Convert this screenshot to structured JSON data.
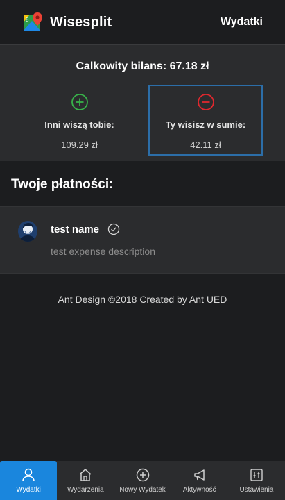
{
  "header": {
    "brand": "Wisesplit",
    "link": "Wydatki",
    "logo_icon": "map-pin-logo-icon"
  },
  "balance": {
    "total_label": "Calkowity bilans: 67.18 zł",
    "owed_to_you": {
      "label": "Inni wiszą tobie:",
      "value": "109.29 zł",
      "icon": "plus-circle-icon",
      "color": "#38b24a"
    },
    "you_owe": {
      "label": "Ty wisisz w sumie:",
      "value": "42.11 zł",
      "icon": "minus-circle-icon",
      "color": "#e0282e"
    }
  },
  "payments": {
    "title": "Twoje płatności:",
    "items": [
      {
        "name": "test name",
        "description": "test expense description",
        "status_icon": "check-circle-icon"
      }
    ]
  },
  "footer": {
    "text": "Ant Design ©2018 Created by Ant UED"
  },
  "nav": {
    "items": [
      {
        "label": "Wydatki",
        "icon": "user-icon",
        "active": true
      },
      {
        "label": "Wydarzenia",
        "icon": "home-icon",
        "active": false
      },
      {
        "label": "Nowy Wydatek",
        "icon": "plus-circle-icon",
        "active": false
      },
      {
        "label": "Aktywność",
        "icon": "megaphone-icon",
        "active": false
      },
      {
        "label": "Ustawienia",
        "icon": "sliders-icon",
        "active": false
      }
    ]
  },
  "colors": {
    "accent": "#1a86dd",
    "selected_border": "#2c6ea8",
    "background": "#1c1d1f",
    "panel": "#2b2c2e"
  }
}
